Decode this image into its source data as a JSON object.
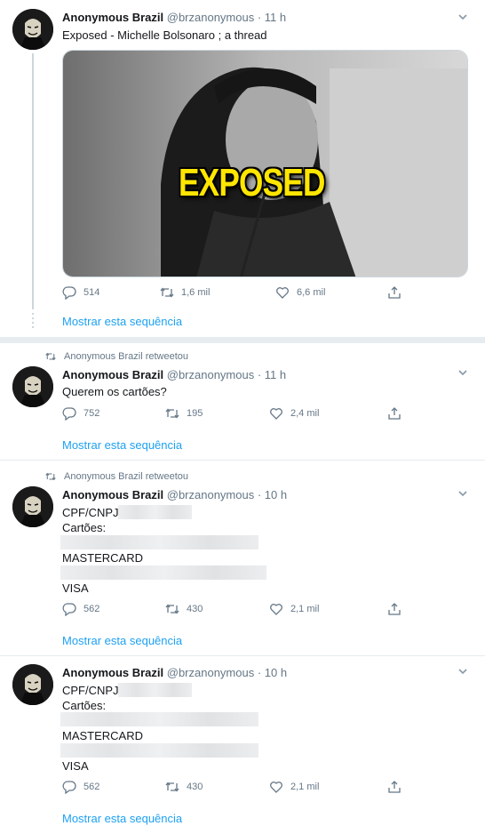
{
  "tweets": [
    {
      "name": "Anonymous Brazil",
      "handle": "@brzanonymous",
      "time": "· 11 h",
      "text": "Exposed - Michelle Bolsonaro ; a thread",
      "media_overlay": "EXPOSED",
      "replies": "514",
      "retweets": "1,6 mil",
      "likes": "6,6 mil",
      "show_thread": "Mostrar esta sequência"
    },
    {
      "retweeted_by": "Anonymous Brazil retweetou",
      "name": "Anonymous Brazil",
      "handle": "@brzanonymous",
      "time": "· 11 h",
      "text": "Querem os cartões?",
      "replies": "752",
      "retweets": "195",
      "likes": "2,4 mil",
      "show_thread": "Mostrar esta sequência"
    },
    {
      "retweeted_by": "Anonymous Brazil retweetou",
      "name": "Anonymous Brazil",
      "handle": "@brzanonymous",
      "time": "· 10 h",
      "line1": "CPF/CNPJ:",
      "line2": "Cartões:",
      "line3": "MASTERCARD",
      "line4": "VISA",
      "replies": "562",
      "retweets": "430",
      "likes": "2,1 mil",
      "show_thread": "Mostrar esta sequência"
    },
    {
      "name": "Anonymous Brazil",
      "handle": "@brzanonymous",
      "time": "· 10 h",
      "line1": "CPF/CNPJ:",
      "line2": "Cartões:",
      "line3": "MASTERCARD",
      "line4": "VISA",
      "replies": "562",
      "retweets": "430",
      "likes": "2,1 mil",
      "show_thread": "Mostrar esta sequência"
    }
  ],
  "colors": {
    "accent": "#1da1f2",
    "muted": "#657786",
    "overlay_text": "#ffe600"
  },
  "icons": [
    "reply-icon",
    "retweet-icon",
    "like-icon",
    "share-icon",
    "caret-down-icon",
    "avatar-mask-icon"
  ]
}
